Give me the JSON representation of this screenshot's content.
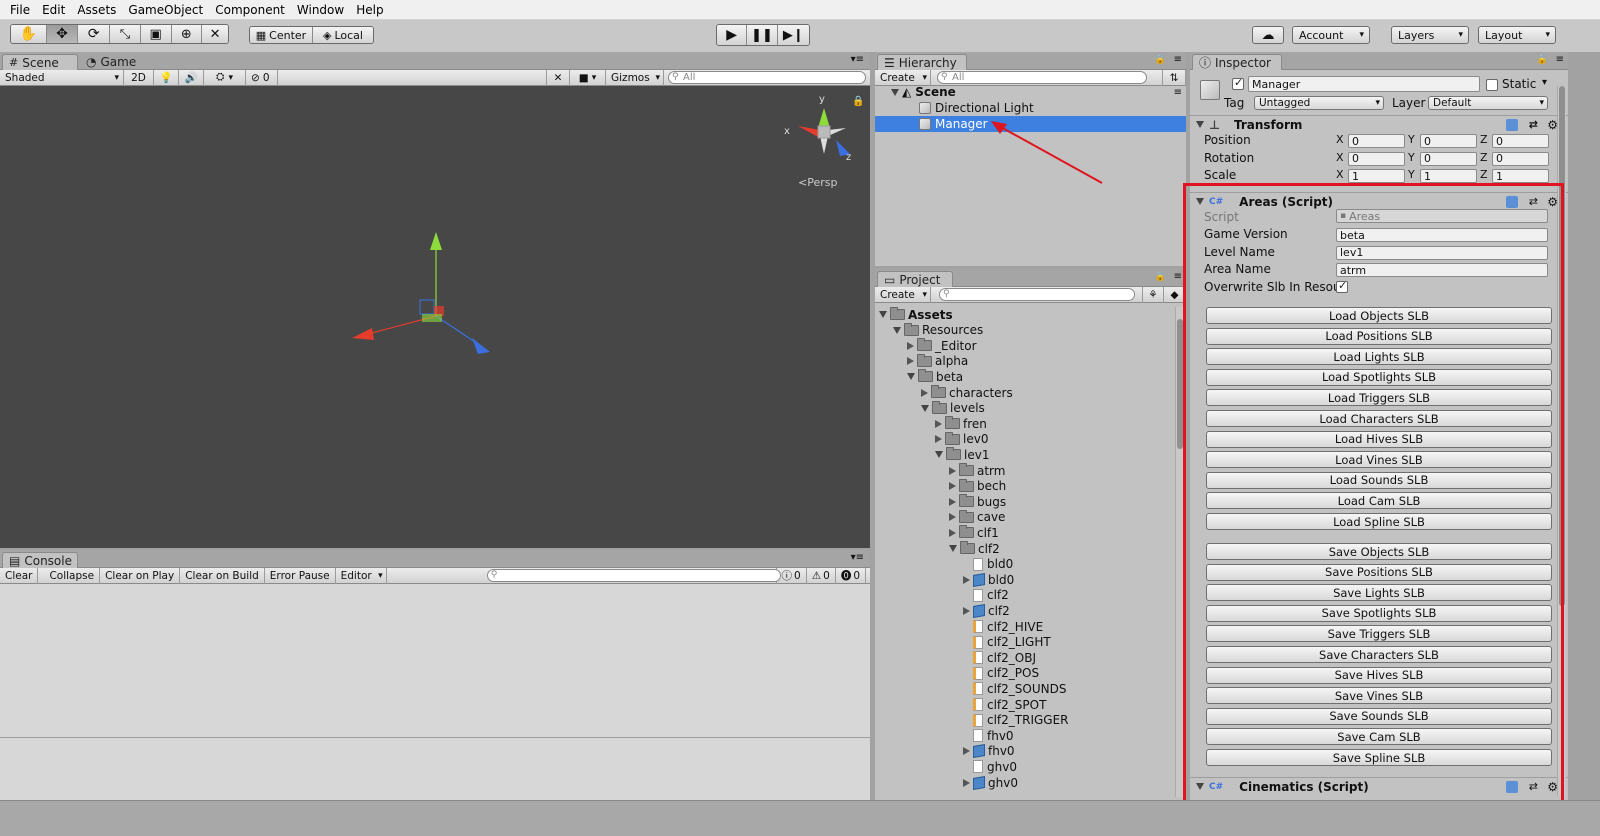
{
  "menu": [
    "File",
    "Edit",
    "Assets",
    "GameObject",
    "Component",
    "Window",
    "Help"
  ],
  "toolbar": {
    "pivot": "Center",
    "space": "Local",
    "account": "Account",
    "layers": "Layers",
    "layout": "Layout"
  },
  "scene": {
    "tab_scene": "Scene",
    "tab_game": "Game",
    "shading": "Shaded",
    "mode2d": "2D",
    "hidden_count": "0",
    "gizmos": "Gizmos",
    "search_placeholder": "All",
    "persp": "Persp",
    "axis_x": "x",
    "axis_y": "y",
    "axis_z": "z"
  },
  "console": {
    "tab": "Console",
    "buttons": [
      "Clear",
      "Collapse",
      "Clear on Play",
      "Clear on Build",
      "Error Pause",
      "Editor"
    ],
    "info_count": "0",
    "warn_count": "0",
    "error_count": "0"
  },
  "hierarchy": {
    "tab": "Hierarchy",
    "create": "Create",
    "search_placeholder": "All",
    "scene_name": "Scene",
    "items": [
      "Directional Light",
      "Manager"
    ]
  },
  "project": {
    "tab": "Project",
    "create": "Create",
    "tree": [
      {
        "label": "Assets",
        "type": "folder",
        "depth": 0,
        "open": true,
        "bold": true
      },
      {
        "label": "Resources",
        "type": "folder",
        "depth": 1,
        "open": true
      },
      {
        "label": "_Editor",
        "type": "folder",
        "depth": 2,
        "open": false
      },
      {
        "label": "alpha",
        "type": "folder",
        "depth": 2,
        "open": false
      },
      {
        "label": "beta",
        "type": "folder",
        "depth": 2,
        "open": true
      },
      {
        "label": "characters",
        "type": "folder",
        "depth": 3,
        "open": false
      },
      {
        "label": "levels",
        "type": "folder",
        "depth": 3,
        "open": true
      },
      {
        "label": "fren",
        "type": "folder",
        "depth": 4,
        "open": false
      },
      {
        "label": "lev0",
        "type": "folder",
        "depth": 4,
        "open": false
      },
      {
        "label": "lev1",
        "type": "folder",
        "depth": 4,
        "open": true
      },
      {
        "label": "atrm",
        "type": "folder",
        "depth": 5,
        "open": false
      },
      {
        "label": "bech",
        "type": "folder",
        "depth": 5,
        "open": false
      },
      {
        "label": "bugs",
        "type": "folder",
        "depth": 5,
        "open": false
      },
      {
        "label": "cave",
        "type": "folder",
        "depth": 5,
        "open": false
      },
      {
        "label": "clf1",
        "type": "folder",
        "depth": 5,
        "open": false
      },
      {
        "label": "clf2",
        "type": "folder",
        "depth": 5,
        "open": true
      },
      {
        "label": "bld0",
        "type": "file",
        "depth": 6
      },
      {
        "label": "bld0",
        "type": "prefab",
        "depth": 6
      },
      {
        "label": "clf2",
        "type": "file",
        "depth": 6
      },
      {
        "label": "clf2",
        "type": "prefab",
        "depth": 6
      },
      {
        "label": "clf2_HIVE",
        "type": "text",
        "depth": 6
      },
      {
        "label": "clf2_LIGHT",
        "type": "text",
        "depth": 6
      },
      {
        "label": "clf2_OBJ",
        "type": "text",
        "depth": 6
      },
      {
        "label": "clf2_POS",
        "type": "text",
        "depth": 6
      },
      {
        "label": "clf2_SOUNDS",
        "type": "text",
        "depth": 6
      },
      {
        "label": "clf2_SPOT",
        "type": "text",
        "depth": 6
      },
      {
        "label": "clf2_TRIGGER",
        "type": "text",
        "depth": 6
      },
      {
        "label": "fhv0",
        "type": "file",
        "depth": 6
      },
      {
        "label": "fhv0",
        "type": "prefab",
        "depth": 6
      },
      {
        "label": "ghv0",
        "type": "file",
        "depth": 6
      },
      {
        "label": "ghv0",
        "type": "prefab",
        "depth": 6
      }
    ]
  },
  "inspector": {
    "tab": "Inspector",
    "object_name": "Manager",
    "static_label": "Static",
    "tag_label": "Tag",
    "tag_value": "Untagged",
    "layer_label": "Layer",
    "layer_value": "Default",
    "transform": {
      "title": "Transform",
      "rows": [
        {
          "label": "Position",
          "x": "0",
          "y": "0",
          "z": "0"
        },
        {
          "label": "Rotation",
          "x": "0",
          "y": "0",
          "z": "0"
        },
        {
          "label": "Scale",
          "x": "1",
          "y": "1",
          "z": "1"
        }
      ],
      "axis_x": "X",
      "axis_y": "Y",
      "axis_z": "Z"
    },
    "areas": {
      "title": "Areas (Script)",
      "script_label": "Script",
      "script_value": "Areas",
      "fields": [
        {
          "label": "Game Version",
          "value": "beta"
        },
        {
          "label": "Level Name",
          "value": "lev1"
        },
        {
          "label": "Area Name",
          "value": "atrm"
        }
      ],
      "overwrite_label": "Overwrite Slb In Resour",
      "load_buttons": [
        "Load Objects SLB",
        "Load Positions SLB",
        "Load Lights SLB",
        "Load Spotlights SLB",
        "Load Triggers SLB",
        "Load Characters SLB",
        "Load Hives SLB",
        "Load Vines SLB",
        "Load Sounds SLB",
        "Load Cam SLB",
        "Load Spline SLB"
      ],
      "save_buttons": [
        "Save Objects SLB",
        "Save Positions SLB",
        "Save Lights SLB",
        "Save Spotlights SLB",
        "Save Triggers SLB",
        "Save Characters SLB",
        "Save Hives SLB",
        "Save Vines SLB",
        "Save Sounds SLB",
        "Save Cam SLB",
        "Save Spline SLB"
      ]
    },
    "cinematics_title": "Cinematics (Script)"
  },
  "colors": {
    "selection": "#3d80df",
    "highlight_box": "#e0141e",
    "arrow": "#e0141e"
  }
}
